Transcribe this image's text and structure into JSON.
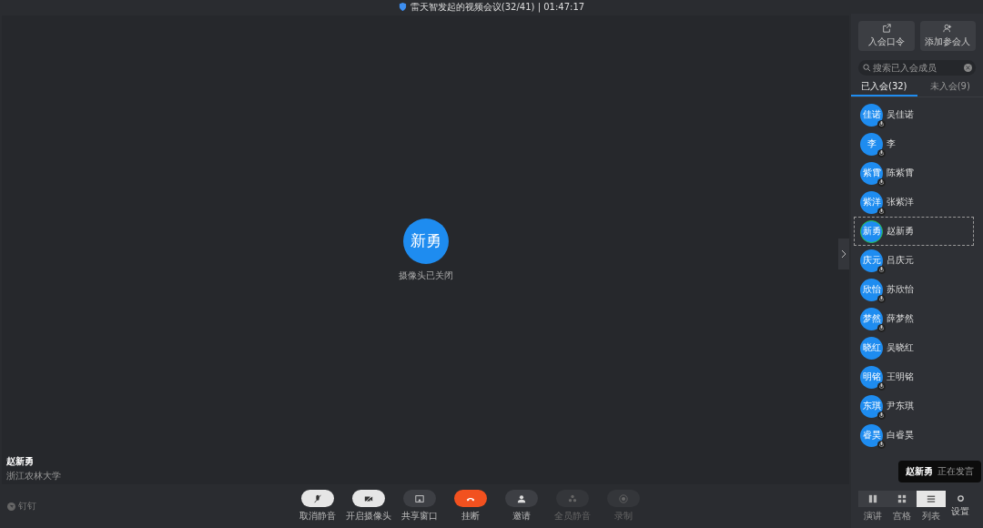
{
  "window": {
    "title": "雷天智发起的视频会议(32/41) | 01:47:17"
  },
  "stage": {
    "avatar": "新勇",
    "status": "摄像头已关闭",
    "speaker_name": "赵新勇",
    "speaker_org": "浙江农林大学"
  },
  "brand": "钉钉",
  "toolbar": [
    {
      "label": "取消静音",
      "kind": "light"
    },
    {
      "label": "开启摄像头",
      "kind": "light"
    },
    {
      "label": "共享窗口",
      "kind": "dark"
    },
    {
      "label": "挂断",
      "kind": "danger"
    },
    {
      "label": "邀请",
      "kind": "dark"
    },
    {
      "label": "全员静音",
      "kind": "disabled"
    },
    {
      "label": "录制",
      "kind": "disabled"
    }
  ],
  "sidebar": {
    "actions": [
      {
        "label": "入会口令"
      },
      {
        "label": "添加参会人"
      }
    ],
    "search": {
      "placeholder": "搜索已入会成员"
    },
    "tabs": [
      {
        "label": "已入会(32)",
        "selected": true
      },
      {
        "label": "未入会(9)",
        "selected": false
      }
    ],
    "participants": [
      {
        "avatar": "佳诺",
        "name": "吴佳诺",
        "muted": true,
        "selected": false
      },
      {
        "avatar": "李",
        "name": "李",
        "muted": true,
        "selected": false
      },
      {
        "avatar": "紫霄",
        "name": "陈紫霄",
        "muted": true,
        "selected": false
      },
      {
        "avatar": "紫洋",
        "name": "张紫洋",
        "muted": true,
        "selected": false
      },
      {
        "avatar": "新勇",
        "name": "赵新勇",
        "muted": false,
        "speaking": true,
        "selected": true
      },
      {
        "avatar": "庆元",
        "name": "吕庆元",
        "muted": true,
        "selected": false
      },
      {
        "avatar": "欣怡",
        "name": "苏欣怡",
        "muted": true,
        "selected": false
      },
      {
        "avatar": "梦然",
        "name": "薛梦然",
        "muted": true,
        "selected": false
      },
      {
        "avatar": "晓红",
        "name": "吴晓红",
        "muted": false,
        "selected": false
      },
      {
        "avatar": "明铭",
        "name": "王明铭",
        "muted": true,
        "selected": false
      },
      {
        "avatar": "东琪",
        "name": "尹东琪",
        "muted": true,
        "selected": false
      },
      {
        "avatar": "睿昊",
        "name": "白睿昊",
        "muted": true,
        "selected": false
      }
    ],
    "toast": {
      "name": "赵新勇",
      "text": "正在发言"
    },
    "views": [
      {
        "label": "演讲",
        "selected": false
      },
      {
        "label": "宫格",
        "selected": false
      },
      {
        "label": "列表",
        "selected": true
      }
    ],
    "settings": {
      "label": "设置"
    }
  }
}
